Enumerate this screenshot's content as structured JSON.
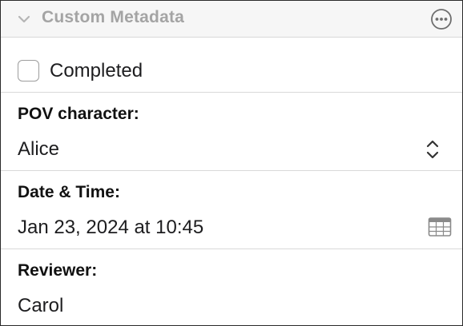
{
  "panel": {
    "title": "Custom Metadata",
    "icons": {
      "collapse": "chevron-down-icon",
      "more": "ellipsis-circle-icon"
    }
  },
  "completed": {
    "label": "Completed",
    "checked": false
  },
  "fields": {
    "pov": {
      "label": "POV character:",
      "value": "Alice",
      "icon": "up-down-chevron-icon"
    },
    "date": {
      "label": "Date & Time:",
      "value": "Jan 23, 2024 at 10:45",
      "icon": "calendar-icon"
    },
    "reviewer": {
      "label": "Reviewer:",
      "value": "Carol"
    }
  },
  "colors": {
    "header_bg": "#f6f6f6",
    "header_text": "#a4a4a4",
    "divider": "#d9d9d9",
    "icon": "#6e6e6e"
  }
}
